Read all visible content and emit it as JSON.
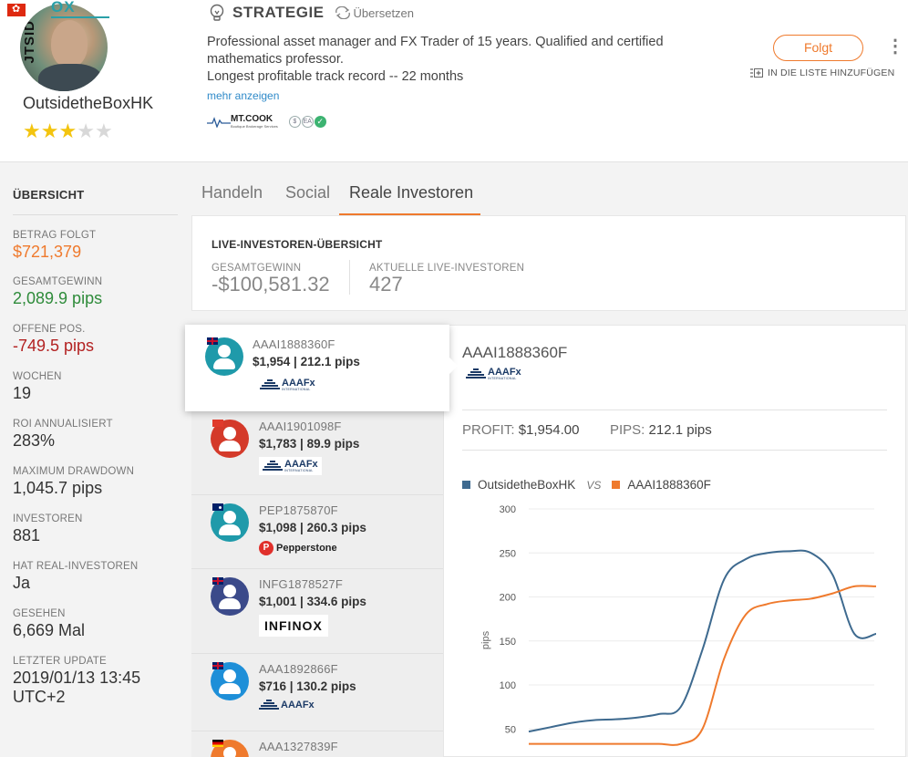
{
  "header": {
    "logo_text": "OX",
    "avatar_side_text": "JTSID",
    "username": "OutsidetheBoxHK",
    "rating": 3,
    "max_rating": 5,
    "strategy_title": "STRATEGIE",
    "translate_label": "Übersetzen",
    "description_lines": [
      "Professional asset manager and FX Trader of 15 years.  Qualified and certified",
      "mathematics professor.",
      "Longest profitable track record -- 22 months"
    ],
    "more_link": "mehr anzeigen",
    "broker_logo": {
      "name": "MT.COOK",
      "tagline": "Boutique Brokerage Services"
    },
    "badges": [
      "$",
      "EA",
      "✓"
    ],
    "follow_button": "Folgt",
    "add_to_list": "IN DIE LISTE HINZUFÜGEN"
  },
  "sidebar": {
    "title": "ÜBERSICHT",
    "stats": [
      {
        "label": "BETRAG FOLGT",
        "value": "$721,379",
        "color": "orange"
      },
      {
        "label": "GESAMTGEWINN",
        "value": "2,089.9 pips",
        "color": "green"
      },
      {
        "label": "OFFENE POS.",
        "value": "-749.5 pips",
        "color": "red"
      },
      {
        "label": "WOCHEN",
        "value": "19",
        "color": "default"
      },
      {
        "label": "ROI ANNUALISIERT",
        "value": "283%",
        "color": "default"
      },
      {
        "label": "MAXIMUM DRAWDOWN",
        "value": "1,045.7 pips",
        "color": "default"
      },
      {
        "label": "INVESTOREN",
        "value": "881",
        "color": "default"
      },
      {
        "label": "HAT REAL-INVESTOREN",
        "value": "Ja",
        "color": "default"
      },
      {
        "label": "GESEHEN",
        "value": "6,669 Mal",
        "color": "default"
      },
      {
        "label": "LETZTER UPDATE",
        "value": "2019/01/13 13:45",
        "value2": "UTC+2",
        "color": "default"
      }
    ]
  },
  "tabs": [
    {
      "label": "Handeln",
      "active": false
    },
    {
      "label": "Social",
      "active": false
    },
    {
      "label": "Reale Investoren",
      "active": true
    }
  ],
  "overview": {
    "title": "LIVE-INVESTOREN-ÜBERSICHT",
    "total_profit_label": "GESAMTGEWINN",
    "total_profit_value": "-$100,581.32",
    "live_investors_label": "AKTUELLE LIVE-INVESTOREN",
    "live_investors_value": "427"
  },
  "investors": [
    {
      "id": "AAAI1888360F",
      "perf": "$1,954 | 212.1 pips",
      "broker": "AAAFx",
      "broker_sub": "INTERNATIONAL",
      "flag": "uk",
      "avatar_color": "#1f9aaa",
      "active": true
    },
    {
      "id": "AAAI1901098F",
      "perf": "$1,783 | 89.9 pips",
      "broker": "AAAFx",
      "broker_sub": "INTERNATIONAL",
      "flag": "red",
      "avatar_color": "#d43a2a",
      "active": false
    },
    {
      "id": "PEP1875870F",
      "perf": "$1,098 | 260.3 pips",
      "broker": "Pepperstone",
      "broker_sub": "",
      "flag": "au",
      "avatar_color": "#1f9aaa",
      "active": false
    },
    {
      "id": "INFG1878527F",
      "perf": "$1,001 | 334.6 pips",
      "broker": "INFINOX",
      "broker_sub": "",
      "flag": "uk",
      "avatar_color": "#3b4a8a",
      "active": false
    },
    {
      "id": "AAA1892866F",
      "perf": "$716 | 130.2 pips",
      "broker": "AAAFx",
      "broker_sub": "",
      "flag": "uk",
      "avatar_color": "#1e8fd8",
      "active": false
    },
    {
      "id": "AAA1327839F",
      "perf": "",
      "broker": "",
      "broker_sub": "",
      "flag": "de",
      "avatar_color": "#ef7a2d",
      "active": false
    }
  ],
  "detail": {
    "investor_id": "AAAI1888360F",
    "broker": "AAAFx",
    "broker_sub": "INTERNATIONAL",
    "profit_label": "PROFIT:",
    "profit_value": "$1,954.00",
    "pips_label": "PIPS:",
    "pips_value": "212.1 pips"
  },
  "chart_data": {
    "type": "line",
    "title": "",
    "xlabel": "",
    "ylabel": "pips",
    "ylim": [
      25,
      300
    ],
    "yticks": [
      50,
      100,
      150,
      200,
      250,
      300
    ],
    "x": [
      0,
      1,
      2,
      3,
      4,
      5,
      6,
      7,
      8,
      9,
      10,
      11,
      12,
      13,
      14,
      15,
      16
    ],
    "series": [
      {
        "name": "OutsidetheBoxHK",
        "color": "#3e6a8f",
        "values": [
          47,
          52,
          57,
          60,
          61,
          63,
          67,
          75,
          140,
          220,
          243,
          250,
          252,
          250,
          225,
          158,
          158
        ]
      },
      {
        "name": "AAAI1888360F",
        "color": "#ef7a2d",
        "values": [
          33,
          33,
          33,
          33,
          33,
          33,
          33,
          33,
          50,
          130,
          180,
          192,
          196,
          198,
          204,
          212,
          212
        ]
      }
    ],
    "legend_vs": "VS",
    "legend_position": "top-left",
    "grid": true
  }
}
